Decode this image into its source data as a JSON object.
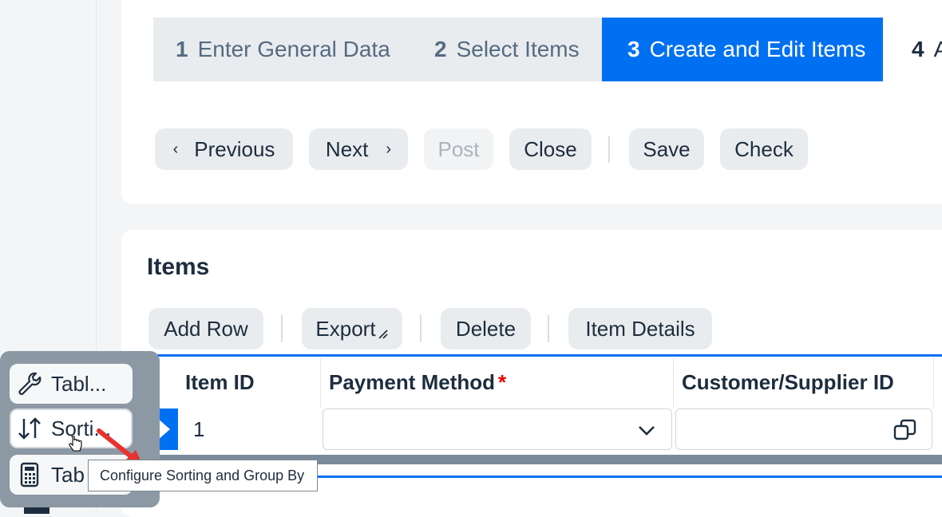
{
  "stepper": {
    "steps": [
      {
        "number": "1",
        "label": "Enter General Data"
      },
      {
        "number": "2",
        "label": "Select Items"
      },
      {
        "number": "3",
        "label": "Create and Edit Items"
      },
      {
        "number": "4",
        "label": "A"
      }
    ],
    "active_step": "3"
  },
  "toolbar": {
    "previous_label": "Previous",
    "next_label": "Next",
    "post_label": "Post",
    "close_label": "Close",
    "save_label": "Save",
    "check_label": "Check"
  },
  "items": {
    "title": "Items",
    "actions": {
      "add_row": "Add Row",
      "export": "Export",
      "delete": "Delete",
      "item_details": "Item Details"
    },
    "columns": [
      "Item ID",
      "Payment Method",
      "Customer/Supplier ID"
    ],
    "rows": [
      {
        "item_id": "1",
        "payment_method": "",
        "customer_supplier_id": ""
      }
    ]
  },
  "popover_menu": {
    "items": [
      {
        "label": "Tabl...",
        "icon": "wrench-icon"
      },
      {
        "label": "Sorti...",
        "icon": "sort-icon"
      },
      {
        "label": "Tab",
        "icon": "calculator-icon"
      }
    ]
  },
  "tooltip": {
    "text": "Configure Sorting and Group By"
  },
  "colors": {
    "accent": "#0070f2",
    "button_bg": "#e9ecef",
    "text": "#1d2d3e"
  }
}
